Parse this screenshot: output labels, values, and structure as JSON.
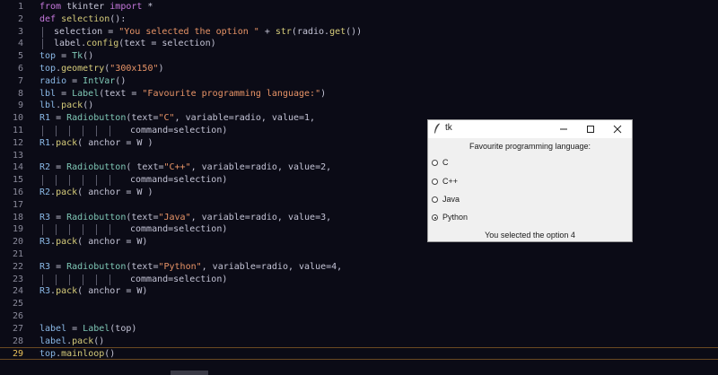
{
  "editor": {
    "current_line": 29,
    "lines": [
      {
        "n": "1",
        "tokens": [
          [
            "kw",
            "from"
          ],
          [
            "op",
            " tkinter "
          ],
          [
            "kw",
            "import"
          ],
          [
            "op",
            " *"
          ]
        ]
      },
      {
        "n": "2",
        "tokens": [
          [
            "kw",
            "def"
          ],
          [
            "op",
            " "
          ],
          [
            "fn",
            "selection"
          ],
          [
            "op",
            "():"
          ]
        ]
      },
      {
        "n": "3",
        "tokens": [
          [
            "op",
            "selection = "
          ],
          [
            "str",
            "\"You selected the option \""
          ],
          [
            "op",
            " + "
          ],
          [
            "fn",
            "str"
          ],
          [
            "op",
            "(radio."
          ],
          [
            "fn",
            "get"
          ],
          [
            "op",
            "())"
          ]
        ]
      },
      {
        "n": "4",
        "tokens": [
          [
            "op",
            "label."
          ],
          [
            "fn",
            "config"
          ],
          [
            "op",
            "(text = selection)"
          ]
        ]
      },
      {
        "n": "5",
        "tokens": [
          [
            "var",
            "top"
          ],
          [
            "op",
            " = "
          ],
          [
            "cls",
            "Tk"
          ],
          [
            "op",
            "()"
          ]
        ]
      },
      {
        "n": "6",
        "tokens": [
          [
            "var",
            "top"
          ],
          [
            "op",
            "."
          ],
          [
            "fn",
            "geometry"
          ],
          [
            "op",
            "("
          ],
          [
            "str",
            "\"300x150\""
          ],
          [
            "op",
            ")"
          ]
        ]
      },
      {
        "n": "7",
        "tokens": [
          [
            "var",
            "radio"
          ],
          [
            "op",
            " = "
          ],
          [
            "cls",
            "IntVar"
          ],
          [
            "op",
            "()"
          ]
        ]
      },
      {
        "n": "8",
        "tokens": [
          [
            "var",
            "lbl"
          ],
          [
            "op",
            " = "
          ],
          [
            "cls",
            "Label"
          ],
          [
            "op",
            "(text = "
          ],
          [
            "str",
            "\"Favourite programming language:\""
          ],
          [
            "op",
            ")"
          ]
        ]
      },
      {
        "n": "9",
        "tokens": [
          [
            "var",
            "lbl"
          ],
          [
            "op",
            "."
          ],
          [
            "fn",
            "pack"
          ],
          [
            "op",
            "()"
          ]
        ]
      },
      {
        "n": "10",
        "tokens": [
          [
            "var",
            "R1"
          ],
          [
            "op",
            " = "
          ],
          [
            "cls",
            "Radiobutton"
          ],
          [
            "op",
            "(text="
          ],
          [
            "str",
            "\"C\""
          ],
          [
            "op",
            ", variable=radio, value=1,"
          ]
        ]
      },
      {
        "n": "11",
        "tokens": [
          [
            "op",
            "command=selection)"
          ]
        ]
      },
      {
        "n": "12",
        "tokens": [
          [
            "var",
            "R1"
          ],
          [
            "op",
            "."
          ],
          [
            "fn",
            "pack"
          ],
          [
            "op",
            "( anchor = W )"
          ]
        ]
      },
      {
        "n": "13",
        "tokens": []
      },
      {
        "n": "14",
        "tokens": [
          [
            "var",
            "R2"
          ],
          [
            "op",
            " = "
          ],
          [
            "cls",
            "Radiobutton"
          ],
          [
            "op",
            "( text="
          ],
          [
            "str",
            "\"C++\""
          ],
          [
            "op",
            ", variable=radio, value=2,"
          ]
        ]
      },
      {
        "n": "15",
        "tokens": [
          [
            "op",
            "command=selection)"
          ]
        ]
      },
      {
        "n": "16",
        "tokens": [
          [
            "var",
            "R2"
          ],
          [
            "op",
            "."
          ],
          [
            "fn",
            "pack"
          ],
          [
            "op",
            "( anchor = W )"
          ]
        ]
      },
      {
        "n": "17",
        "tokens": []
      },
      {
        "n": "18",
        "tokens": [
          [
            "var",
            "R3"
          ],
          [
            "op",
            " = "
          ],
          [
            "cls",
            "Radiobutton"
          ],
          [
            "op",
            "(text="
          ],
          [
            "str",
            "\"Java\""
          ],
          [
            "op",
            ", variable=radio, value=3,"
          ]
        ]
      },
      {
        "n": "19",
        "tokens": [
          [
            "op",
            "command=selection)"
          ]
        ]
      },
      {
        "n": "20",
        "tokens": [
          [
            "var",
            "R3"
          ],
          [
            "op",
            "."
          ],
          [
            "fn",
            "pack"
          ],
          [
            "op",
            "( anchor = W)"
          ]
        ]
      },
      {
        "n": "21",
        "tokens": []
      },
      {
        "n": "22",
        "tokens": [
          [
            "var",
            "R3"
          ],
          [
            "op",
            " = "
          ],
          [
            "cls",
            "Radiobutton"
          ],
          [
            "op",
            "(text="
          ],
          [
            "str",
            "\"Python\""
          ],
          [
            "op",
            ", variable=radio, value=4,"
          ]
        ]
      },
      {
        "n": "23",
        "tokens": [
          [
            "op",
            "command=selection)"
          ]
        ]
      },
      {
        "n": "24",
        "tokens": [
          [
            "var",
            "R3"
          ],
          [
            "op",
            "."
          ],
          [
            "fn",
            "pack"
          ],
          [
            "op",
            "( anchor = W)"
          ]
        ]
      },
      {
        "n": "25",
        "tokens": []
      },
      {
        "n": "26",
        "tokens": []
      },
      {
        "n": "27",
        "tokens": [
          [
            "var",
            "label"
          ],
          [
            "op",
            " = "
          ],
          [
            "cls",
            "Label"
          ],
          [
            "op",
            "(top)"
          ]
        ]
      },
      {
        "n": "28",
        "tokens": [
          [
            "var",
            "label"
          ],
          [
            "op",
            "."
          ],
          [
            "fn",
            "pack"
          ],
          [
            "op",
            "()"
          ]
        ]
      },
      {
        "n": "29",
        "tokens": [
          [
            "var",
            "top"
          ],
          [
            "op",
            "."
          ],
          [
            "fn",
            "mainloop"
          ],
          [
            "op",
            "()"
          ]
        ]
      }
    ]
  },
  "tk_window": {
    "title": "tk",
    "heading": "Favourite programming language:",
    "options": [
      {
        "label": "C",
        "checked": false
      },
      {
        "label": "C++",
        "checked": false
      },
      {
        "label": "Java",
        "checked": false
      },
      {
        "label": "Python",
        "checked": true
      }
    ],
    "result": "You selected the option 4",
    "icons": {
      "app": "feather-icon",
      "minimize": "minimize-icon",
      "maximize": "maximize-icon",
      "close": "close-icon"
    }
  },
  "colors": {
    "editor_bg": "#0b0b16",
    "keyword": "#c678dd",
    "string": "#e89467",
    "function": "#d6cc7a",
    "class": "#7fc8b6",
    "variable": "#8ab8e6",
    "line_number": "#8a8a9a",
    "current_line_number": "#e8c05a"
  }
}
